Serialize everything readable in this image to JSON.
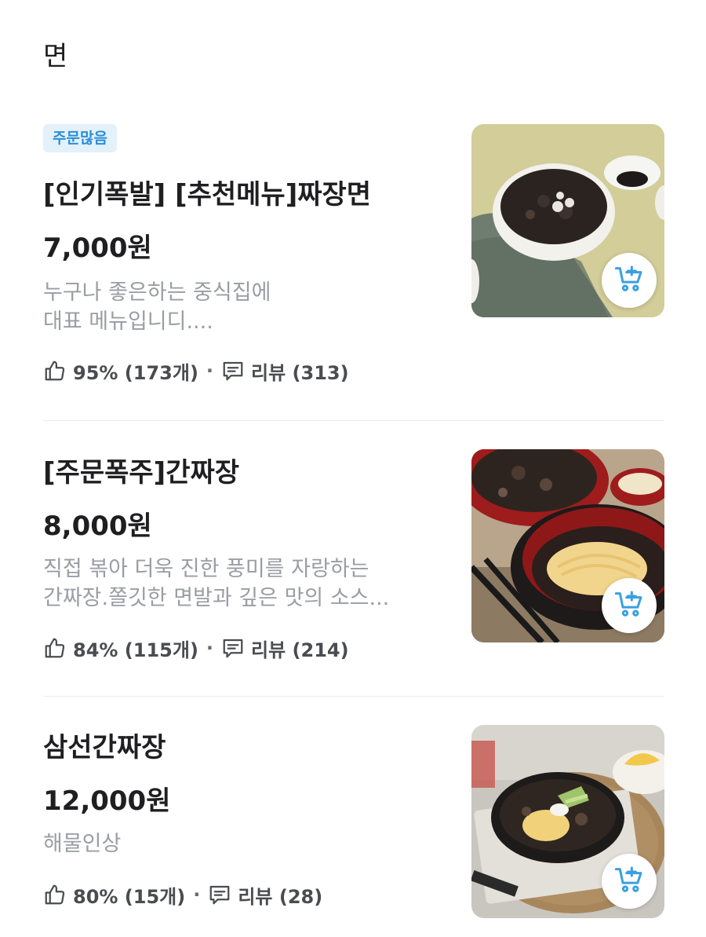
{
  "section": {
    "title": "면"
  },
  "items": [
    {
      "badge": "주문많음",
      "name": "[인기폭발] [추천메뉴]짜장면",
      "price": "7,000원",
      "description": [
        "누구나 좋은하는 중식집에",
        "대표 메뉴입니디...."
      ],
      "rating": "95% (173개)",
      "reviews": "리뷰 (313)"
    },
    {
      "name": "[주문폭주]간짜장",
      "price": "8,000원",
      "description": [
        "직접 볶아 더욱 진한 풍미를 자랑하는",
        "간짜장.쫄깃한 면발과 깊은 맛의 소스..."
      ],
      "rating": "84% (115개)",
      "reviews": "리뷰 (214)"
    },
    {
      "name": "삼선간짜장",
      "price": "12,000원",
      "description": [
        "해물인상"
      ],
      "rating": "80% (15개)",
      "reviews": "리뷰 (28)"
    }
  ],
  "colors": {
    "accent": "#2a8fd6",
    "badge_bg": "#e3f1fb",
    "muted": "#9a9da3",
    "cart_icon": "#3aa0e0"
  },
  "icons": {
    "like": "thumbs-up-icon",
    "review": "speech-bubble-icon",
    "cart": "cart-add-icon"
  }
}
